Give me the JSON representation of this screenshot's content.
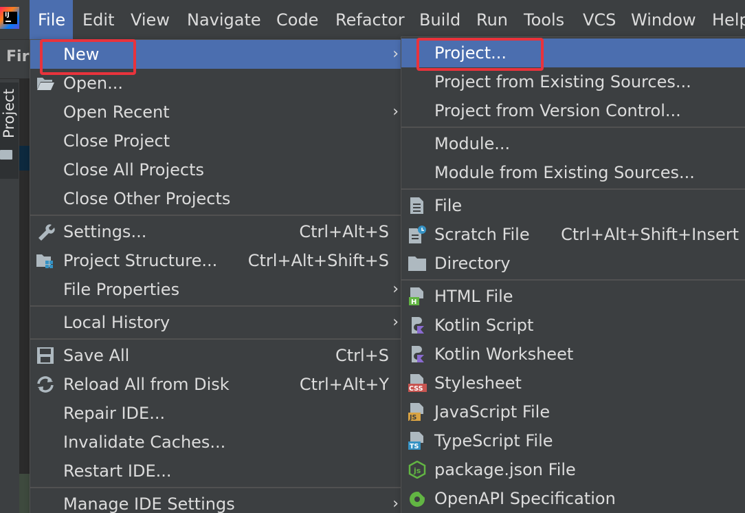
{
  "menubar": {
    "items": [
      "File",
      "Edit",
      "View",
      "Navigate",
      "Code",
      "Refactor",
      "Build",
      "Run",
      "Tools",
      "VCS",
      "Window",
      "Help"
    ],
    "active": "File"
  },
  "background": {
    "toolbar_text": "Firs",
    "project_tab": "Project"
  },
  "file_menu": {
    "items": [
      {
        "label": "New",
        "shortcut": "",
        "submenu": true,
        "icon": ""
      },
      {
        "label": "Open...",
        "shortcut": "",
        "submenu": false,
        "icon": "folder-open-icon"
      },
      {
        "label": "Open Recent",
        "shortcut": "",
        "submenu": true,
        "icon": ""
      },
      {
        "label": "Close Project",
        "shortcut": "",
        "submenu": false,
        "icon": ""
      },
      {
        "label": "Close All Projects",
        "shortcut": "",
        "submenu": false,
        "icon": ""
      },
      {
        "label": "Close Other Projects",
        "shortcut": "",
        "submenu": false,
        "icon": ""
      },
      {
        "label": "Settings...",
        "shortcut": "Ctrl+Alt+S",
        "submenu": false,
        "icon": "wrench-icon"
      },
      {
        "label": "Project Structure...",
        "shortcut": "Ctrl+Alt+Shift+S",
        "submenu": false,
        "icon": "project-structure-icon"
      },
      {
        "label": "File Properties",
        "shortcut": "",
        "submenu": true,
        "icon": ""
      },
      {
        "label": "Local History",
        "shortcut": "",
        "submenu": true,
        "icon": ""
      },
      {
        "label": "Save All",
        "shortcut": "Ctrl+S",
        "submenu": false,
        "icon": "save-icon"
      },
      {
        "label": "Reload All from Disk",
        "shortcut": "Ctrl+Alt+Y",
        "submenu": false,
        "icon": "reload-icon"
      },
      {
        "label": "Repair IDE...",
        "shortcut": "",
        "submenu": false,
        "icon": ""
      },
      {
        "label": "Invalidate Caches...",
        "shortcut": "",
        "submenu": false,
        "icon": ""
      },
      {
        "label": "Restart IDE...",
        "shortcut": "",
        "submenu": false,
        "icon": ""
      },
      {
        "label": "Manage IDE Settings",
        "shortcut": "",
        "submenu": true,
        "icon": ""
      }
    ]
  },
  "new_submenu": {
    "items": [
      {
        "label": "Project...",
        "shortcut": "",
        "icon": ""
      },
      {
        "label": "Project from Existing Sources...",
        "shortcut": "",
        "icon": ""
      },
      {
        "label": "Project from Version Control...",
        "shortcut": "",
        "icon": ""
      },
      {
        "label": "Module...",
        "shortcut": "",
        "icon": ""
      },
      {
        "label": "Module from Existing Sources...",
        "shortcut": "",
        "icon": ""
      },
      {
        "label": "File",
        "shortcut": "",
        "icon": "file-icon"
      },
      {
        "label": "Scratch File",
        "shortcut": "Ctrl+Alt+Shift+Insert",
        "icon": "scratch-file-icon"
      },
      {
        "label": "Directory",
        "shortcut": "",
        "icon": "directory-icon"
      },
      {
        "label": "HTML File",
        "shortcut": "",
        "icon": "html-file-icon",
        "badge": "H"
      },
      {
        "label": "Kotlin Script",
        "shortcut": "",
        "icon": "kotlin-script-icon"
      },
      {
        "label": "Kotlin Worksheet",
        "shortcut": "",
        "icon": "kotlin-worksheet-icon"
      },
      {
        "label": "Stylesheet",
        "shortcut": "",
        "icon": "stylesheet-icon",
        "badge": "CSS"
      },
      {
        "label": "JavaScript File",
        "shortcut": "",
        "icon": "javascript-file-icon",
        "badge": "JS"
      },
      {
        "label": "TypeScript File",
        "shortcut": "",
        "icon": "typescript-file-icon",
        "badge": "TS"
      },
      {
        "label": "package.json File",
        "shortcut": "",
        "icon": "package-json-icon"
      },
      {
        "label": "OpenAPI Specification",
        "shortcut": "",
        "icon": "openapi-icon"
      }
    ]
  },
  "colors": {
    "menu_bg": "#3c3f41",
    "highlight": "#4b6eaf",
    "annotation_red": "#e8333c"
  }
}
